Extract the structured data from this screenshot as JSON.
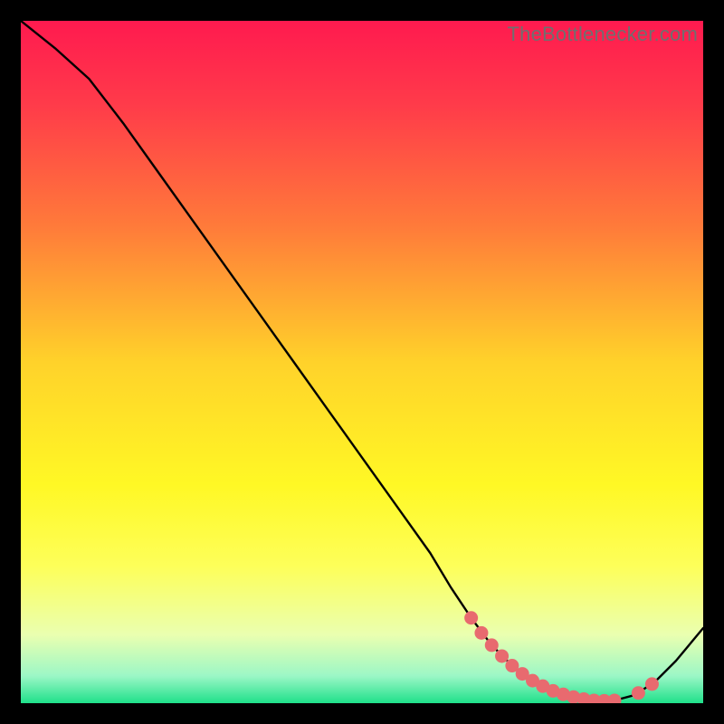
{
  "watermark": "TheBottlenecker.com",
  "chart_data": {
    "type": "line",
    "title": "",
    "xlabel": "",
    "ylabel": "",
    "xlim": [
      0,
      100
    ],
    "ylim": [
      0,
      100
    ],
    "x": [
      0,
      5,
      10,
      15,
      20,
      25,
      30,
      35,
      40,
      45,
      50,
      55,
      60,
      63,
      66,
      69,
      72,
      75,
      78,
      81,
      84,
      87,
      90,
      93,
      96,
      100
    ],
    "y": [
      100,
      96,
      91.5,
      85,
      78,
      71,
      64,
      57,
      50,
      43,
      36,
      29,
      22,
      17,
      12.5,
      8.5,
      5.5,
      3.3,
      1.8,
      0.9,
      0.4,
      0.4,
      1.2,
      3.2,
      6.2,
      11
    ],
    "markers": {
      "x": [
        66,
        67.5,
        69,
        70.5,
        72,
        73.5,
        75,
        76.5,
        78,
        79.5,
        81,
        82.5,
        84,
        85.5,
        87,
        90.5,
        92.5
      ],
      "y": [
        12.5,
        10.3,
        8.5,
        6.9,
        5.5,
        4.3,
        3.3,
        2.5,
        1.8,
        1.3,
        0.9,
        0.6,
        0.4,
        0.35,
        0.4,
        1.5,
        2.8
      ]
    },
    "gradient_stops": [
      {
        "offset": 0.0,
        "color": "#ff1a4f"
      },
      {
        "offset": 0.12,
        "color": "#ff3a4a"
      },
      {
        "offset": 0.3,
        "color": "#ff7a3a"
      },
      {
        "offset": 0.5,
        "color": "#ffd22a"
      },
      {
        "offset": 0.68,
        "color": "#fff825"
      },
      {
        "offset": 0.8,
        "color": "#fdff5a"
      },
      {
        "offset": 0.9,
        "color": "#eaffb0"
      },
      {
        "offset": 0.96,
        "color": "#9cf7c6"
      },
      {
        "offset": 1.0,
        "color": "#1fe08a"
      }
    ],
    "marker_color": "#e86a6f",
    "line_color": "#000000"
  }
}
